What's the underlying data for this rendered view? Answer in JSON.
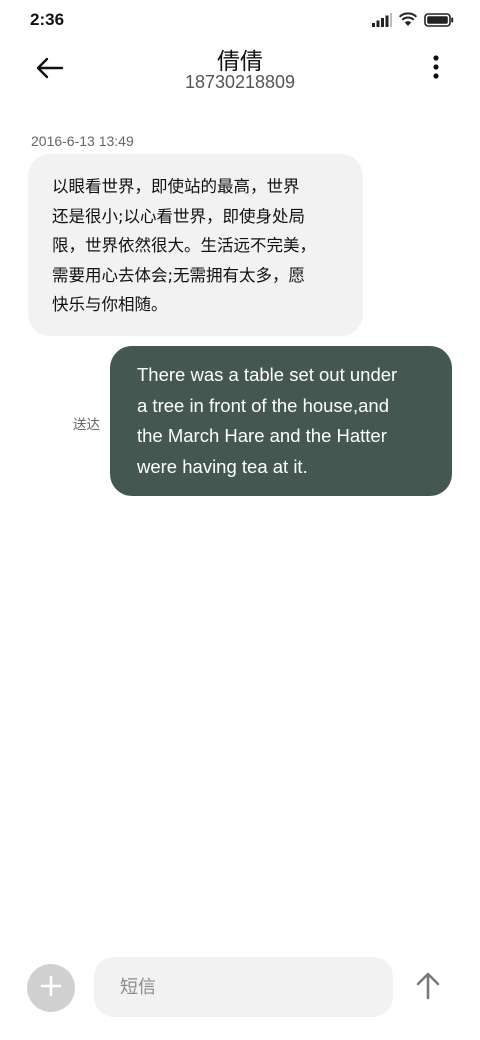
{
  "status_bar": {
    "time": "2:36",
    "icons": [
      "signal-icon",
      "wifi-icon",
      "battery-icon"
    ]
  },
  "header": {
    "contact_name": "倩倩",
    "phone_number": "18730218809",
    "back_icon": "arrow-left-icon",
    "menu_icon": "more-vertical-icon"
  },
  "conversation": {
    "timestamp": "2016-6-13 13:49",
    "incoming_message": {
      "lines": [
        "以眼看世界，即使站的最高，世界",
        "还是很小;以心看世界，即使身处局",
        "限，世界依然很大。生活远不完美，",
        "需要用心去体会;无需拥有太多，愿",
        "快乐与你相随。"
      ]
    },
    "outgoing_message": {
      "lines": [
        "There was a table set out under",
        "a tree in front of the house,and",
        "the March Hare and the Hatter",
        "were having tea at it."
      ],
      "status": "送达"
    }
  },
  "composer": {
    "placeholder": "短信",
    "value": "",
    "add_icon": "plus-icon",
    "send_icon": "arrow-up-icon"
  },
  "colors": {
    "outgoing_bubble": "#455751",
    "incoming_bubble": "#f2f2f2",
    "add_button": "#d0d0d0"
  }
}
